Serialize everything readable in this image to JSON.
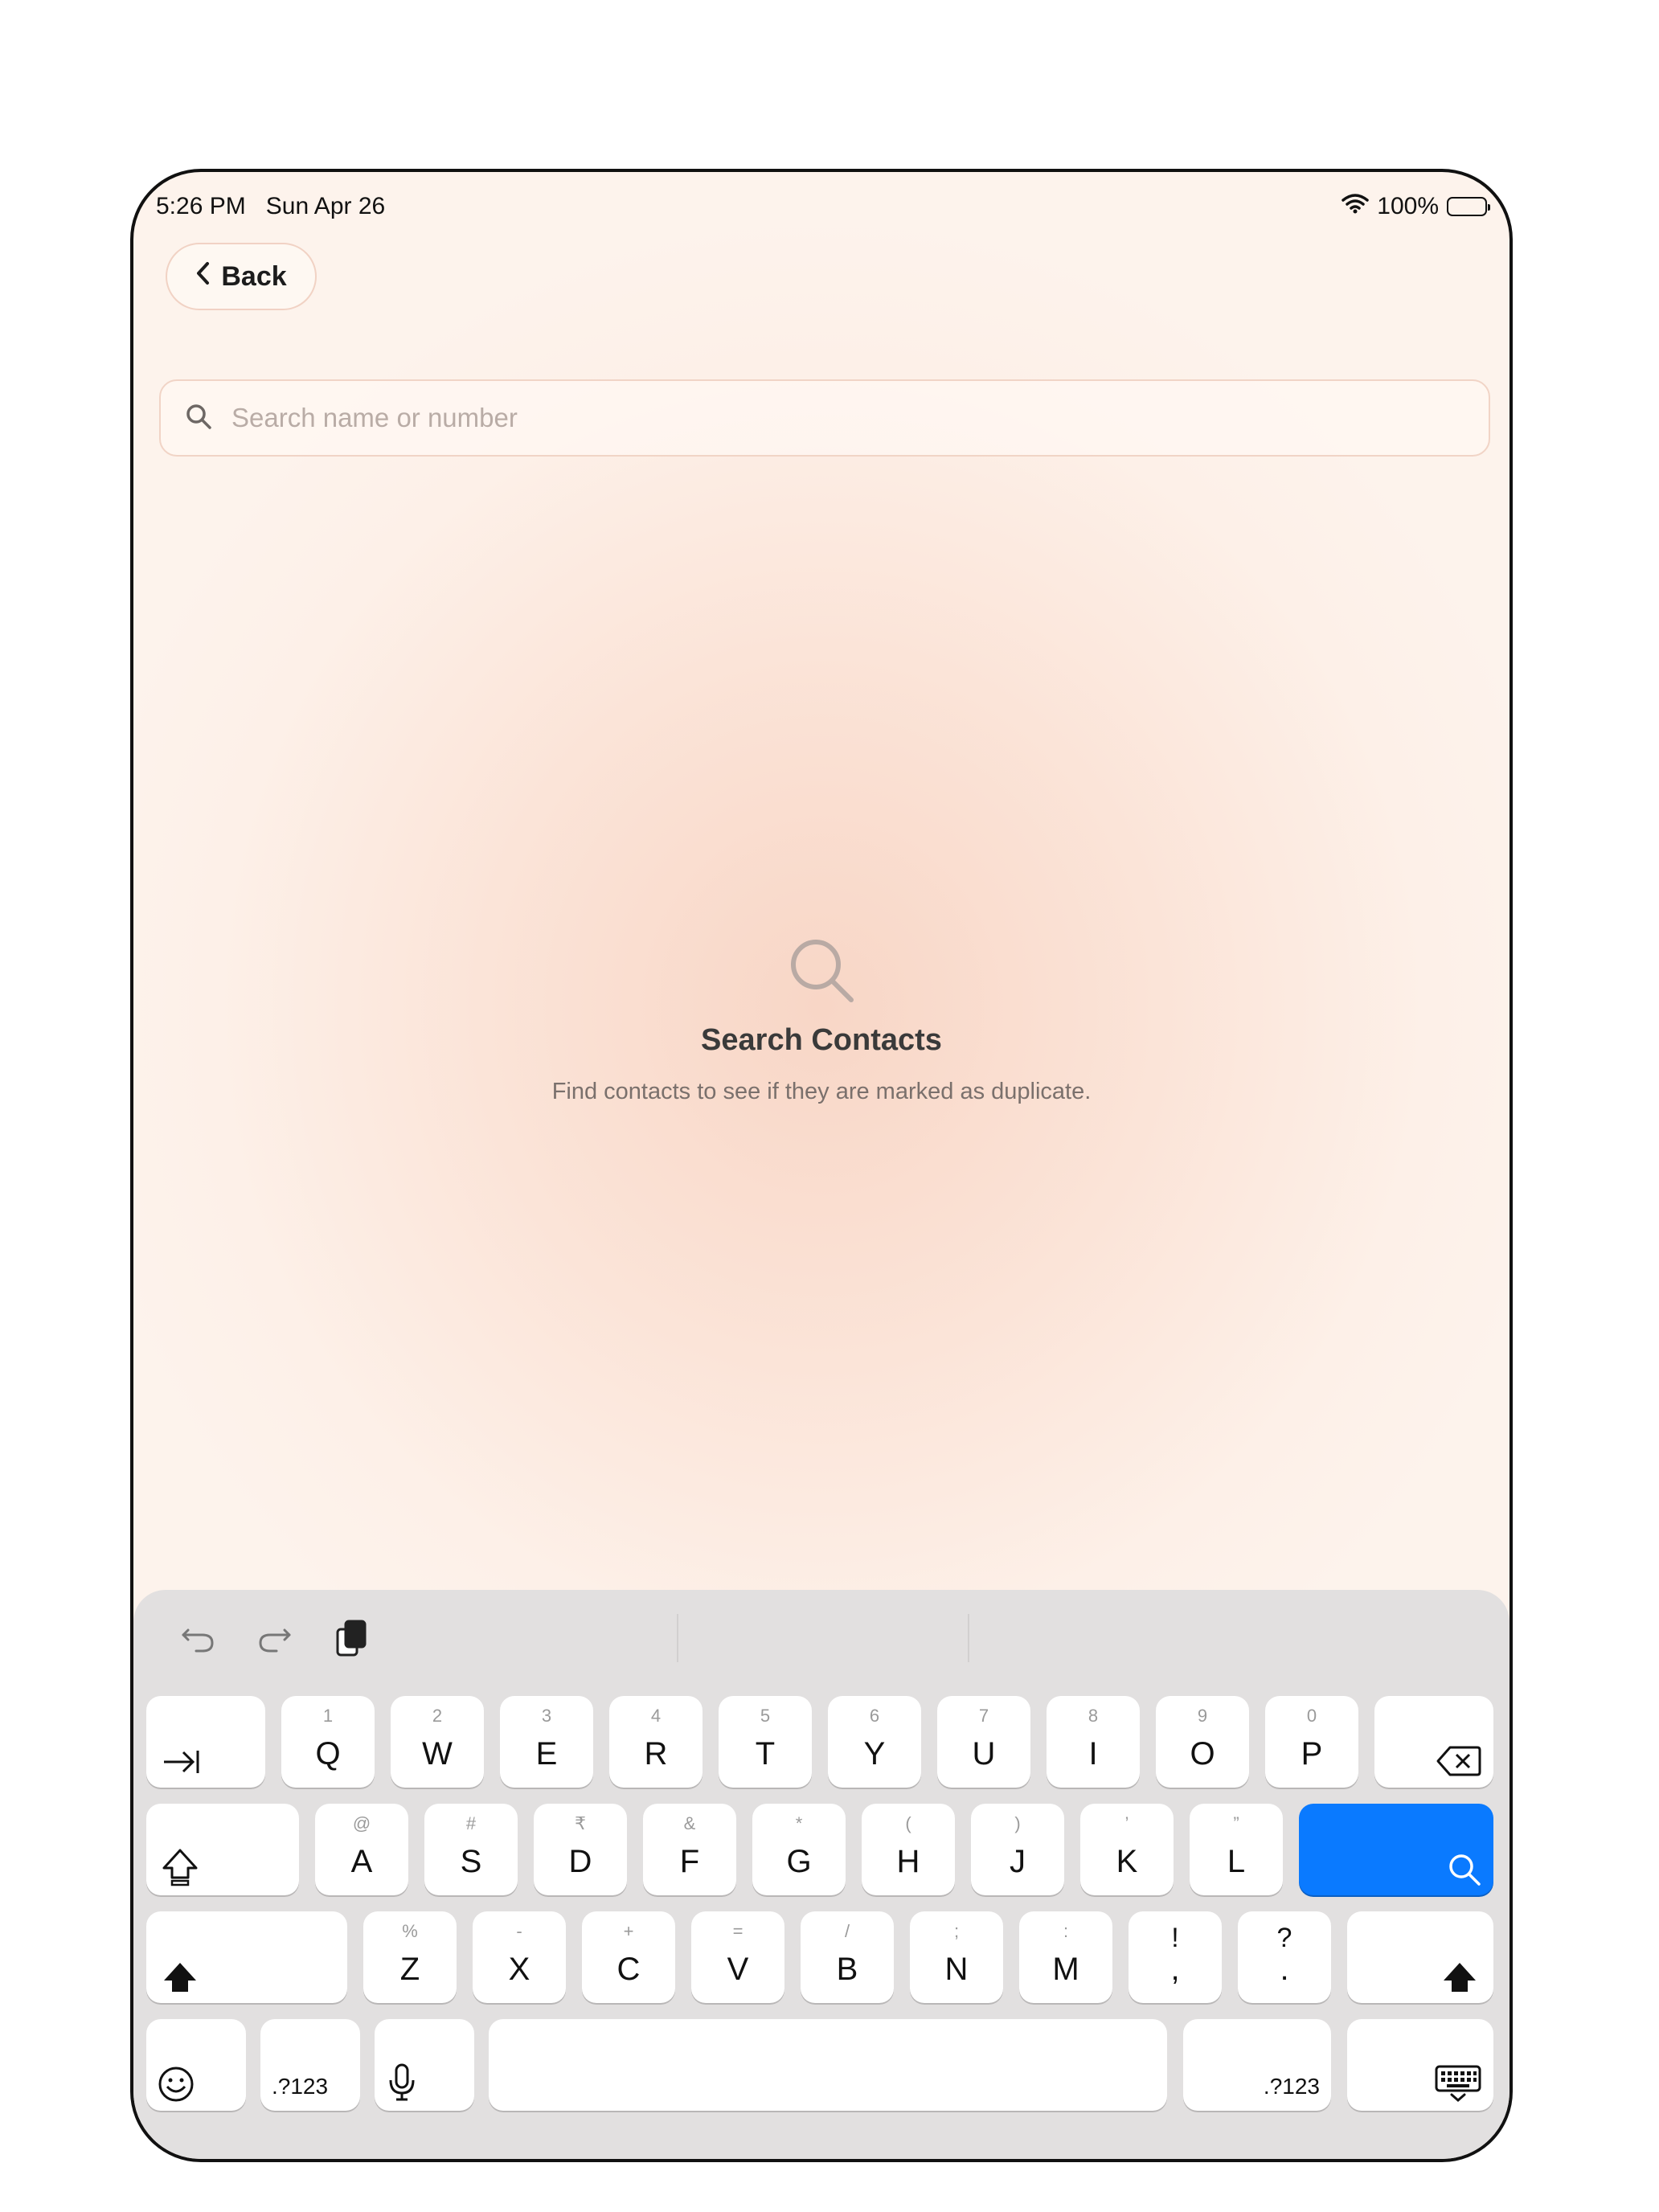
{
  "status_bar": {
    "time": "5:26 PM",
    "date": "Sun Apr 26",
    "battery": "100%"
  },
  "nav": {
    "back_label": "Back"
  },
  "search": {
    "placeholder": "Search name or number",
    "value": ""
  },
  "empty_state": {
    "title": "Search Contacts",
    "description": "Find contacts to see if they are marked as duplicate."
  },
  "keyboard": {
    "row1": [
      {
        "sub": "1",
        "main": "Q"
      },
      {
        "sub": "2",
        "main": "W"
      },
      {
        "sub": "3",
        "main": "E"
      },
      {
        "sub": "4",
        "main": "R"
      },
      {
        "sub": "5",
        "main": "T"
      },
      {
        "sub": "6",
        "main": "Y"
      },
      {
        "sub": "7",
        "main": "U"
      },
      {
        "sub": "8",
        "main": "I"
      },
      {
        "sub": "9",
        "main": "O"
      },
      {
        "sub": "0",
        "main": "P"
      }
    ],
    "row2": [
      {
        "sub": "@",
        "main": "A"
      },
      {
        "sub": "#",
        "main": "S"
      },
      {
        "sub": "₹",
        "main": "D"
      },
      {
        "sub": "&",
        "main": "F"
      },
      {
        "sub": "*",
        "main": "G"
      },
      {
        "sub": "(",
        "main": "H"
      },
      {
        "sub": ")",
        "main": "J"
      },
      {
        "sub": "’",
        "main": "K"
      },
      {
        "sub": "”",
        "main": "L"
      }
    ],
    "row3": [
      {
        "sub": "%",
        "main": "Z"
      },
      {
        "sub": "-",
        "main": "X"
      },
      {
        "sub": "+",
        "main": "C"
      },
      {
        "sub": "=",
        "main": "V"
      },
      {
        "sub": "/",
        "main": "B"
      },
      {
        "sub": ";",
        "main": "N"
      },
      {
        "sub": ":",
        "main": "M"
      },
      {
        "sub": "!",
        "main": ","
      },
      {
        "sub": "?",
        "main": "."
      }
    ],
    "numbers_label_left": ".?123",
    "numbers_label_right": ".?123"
  },
  "colors": {
    "accent": "#0A7AFF",
    "background": "#FBE4D8"
  }
}
